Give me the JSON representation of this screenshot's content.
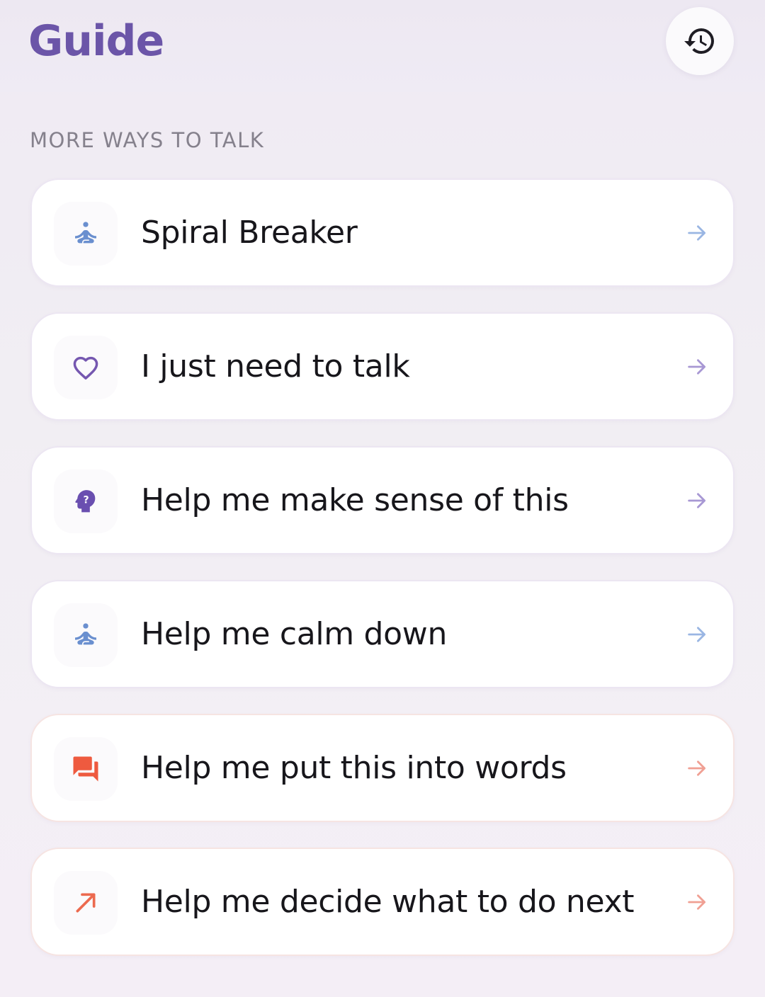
{
  "header": {
    "title": "Guide",
    "history_icon": "history-icon"
  },
  "section": {
    "label": "MORE WAYS TO TALK"
  },
  "items": [
    {
      "label": "Spiral Breaker",
      "icon": "meditation-icon",
      "icon_color": "#6a8fcf",
      "arrow_color": "#9ab6e3",
      "tone": "cool"
    },
    {
      "label": "I just need to talk",
      "icon": "heart-icon",
      "icon_color": "#7557b0",
      "arrow_color": "#a898d4",
      "tone": "cool"
    },
    {
      "label": "Help me make sense of this",
      "icon": "head-question-icon",
      "icon_color": "#6a4fb0",
      "arrow_color": "#a898d4",
      "tone": "cool"
    },
    {
      "label": "Help me calm down",
      "icon": "meditation-icon",
      "icon_color": "#6a8fcf",
      "arrow_color": "#9ab6e3",
      "tone": "cool"
    },
    {
      "label": "Help me put this into words",
      "icon": "chat-bubbles-icon",
      "icon_color": "#ee5a3f",
      "arrow_color": "#f0a094",
      "tone": "warm"
    },
    {
      "label": "Help me decide what to do next",
      "icon": "trending-arrow-icon",
      "icon_color": "#ec6a4f",
      "arrow_color": "#f0a094",
      "tone": "warm"
    }
  ]
}
